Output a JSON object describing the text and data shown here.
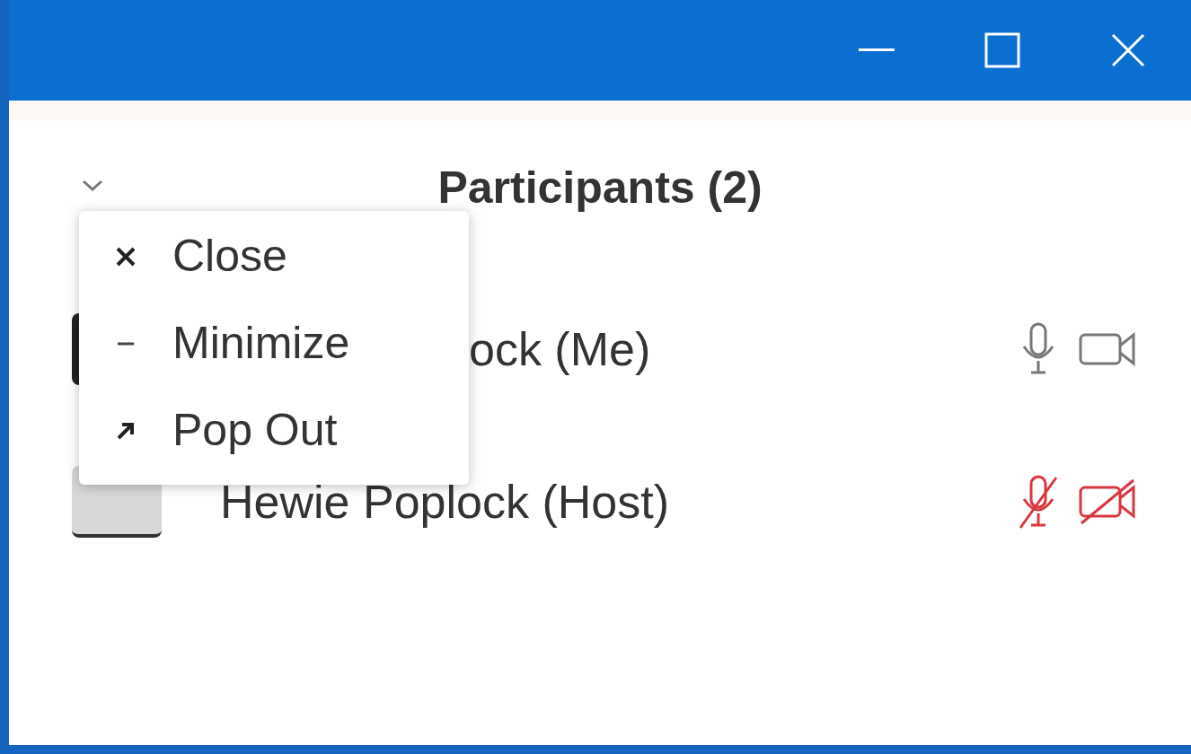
{
  "panel": {
    "title": "Participants (2)"
  },
  "participants": [
    {
      "name": "ock (Me)",
      "partly_hidden": true,
      "mic_muted": false,
      "video_off": false
    },
    {
      "name": "Hewie Poplock (Host)",
      "partly_hidden": false,
      "mic_muted": true,
      "video_off": true
    }
  ],
  "menu": {
    "items": [
      {
        "kind": "close",
        "label": "Close"
      },
      {
        "kind": "minimize",
        "label": "Minimize"
      },
      {
        "kind": "popout",
        "label": "Pop Out"
      }
    ]
  }
}
